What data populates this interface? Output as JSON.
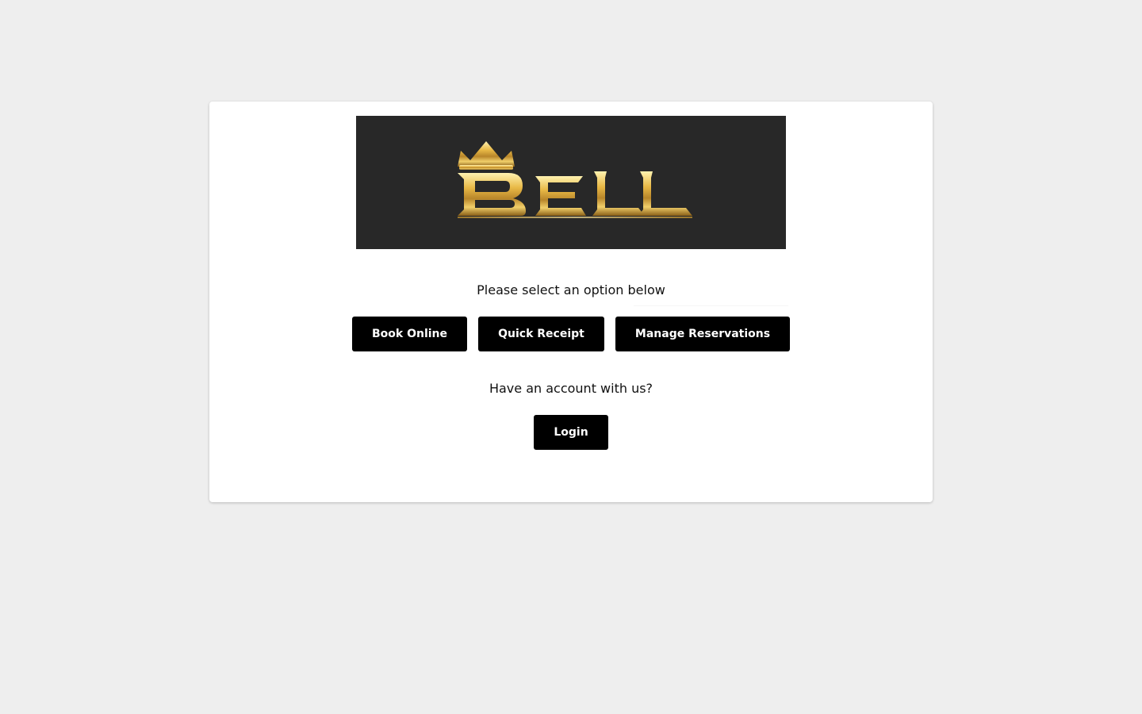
{
  "brand": {
    "logo_text": "BELL",
    "logo_background": "#282828",
    "logo_gold": "#d4a32e"
  },
  "main": {
    "prompt": "Please select an option below",
    "buttons": [
      {
        "label": "Book Online"
      },
      {
        "label": "Quick Receipt"
      },
      {
        "label": "Manage Reservations"
      }
    ],
    "account_prompt": "Have an account with us?",
    "login_label": "Login"
  },
  "colors": {
    "page_bg": "#eeeeee",
    "card_bg": "#ffffff",
    "button_bg": "#000000",
    "button_text": "#ffffff"
  }
}
